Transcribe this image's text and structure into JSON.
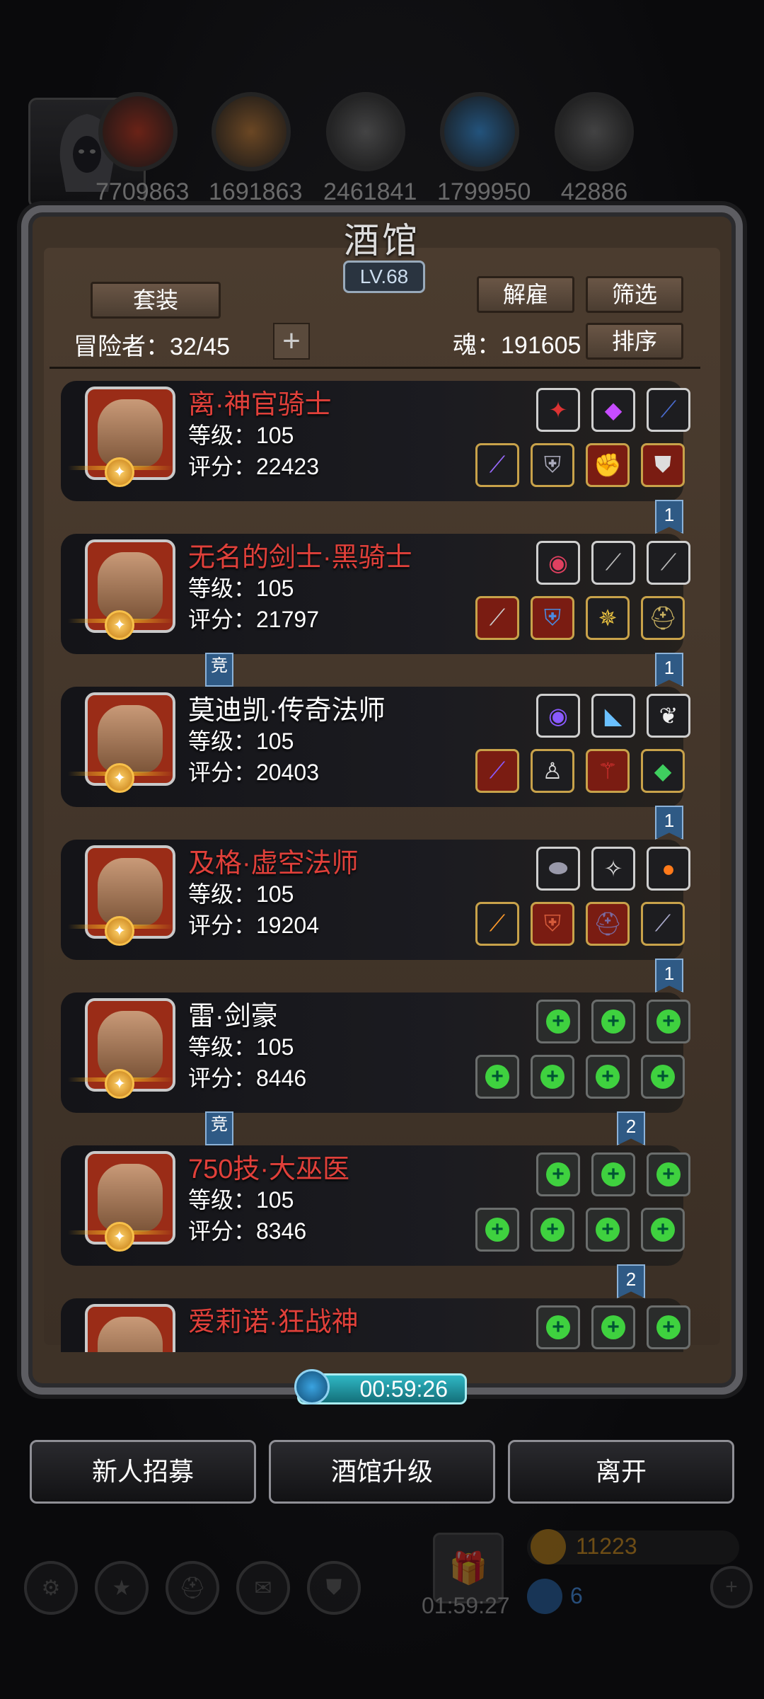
{
  "top_bar": {
    "resources": [
      {
        "icon": "meat-icon",
        "value": "7709863",
        "color": "#8a2a1a"
      },
      {
        "icon": "wood-icon",
        "value": "1691863",
        "color": "#8a5a2a"
      },
      {
        "icon": "iron-icon",
        "value": "2461841",
        "color": "#555555"
      },
      {
        "icon": "crystal-icon",
        "value": "1799950",
        "color": "#2a6aa0"
      },
      {
        "icon": "steel-icon",
        "value": "42886",
        "color": "#555555"
      }
    ]
  },
  "panel": {
    "title": "酒馆",
    "level": "LV.68",
    "set_button": "套装",
    "dismiss_button": "解雇",
    "filter_button": "筛选",
    "sort_button": "排序",
    "adventurer_label": "冒险者：32/45",
    "soul_label": "魂：191605",
    "add_icon": "plus-icon"
  },
  "heroes": [
    {
      "name": "离·神官骑士",
      "name_color": "#e0403a",
      "level": "等级：105",
      "score": "评分：22423",
      "badge": "1",
      "comp": "",
      "top_slots": [
        {
          "icon": "amulet-icon",
          "glyph": "✦",
          "color": "#d33"
        },
        {
          "icon": "gem-icon",
          "glyph": "◆",
          "color": "#c64cff"
        },
        {
          "icon": "bow-icon",
          "glyph": "⟋",
          "color": "#4a6cd0"
        }
      ],
      "bottom_slots": [
        {
          "icon": "staff-icon",
          "glyph": "⟋",
          "color": "#9a6aff",
          "frame": "gold"
        },
        {
          "icon": "armor-icon",
          "glyph": "⛨",
          "color": "#aab",
          "frame": "gold"
        },
        {
          "icon": "gauntlet-icon",
          "glyph": "✊",
          "color": "#e33",
          "frame": "red"
        },
        {
          "icon": "shield-icon",
          "glyph": "⛊",
          "color": "#ddd",
          "frame": "red"
        }
      ]
    },
    {
      "name": "无名的剑士·黑骑士",
      "name_color": "#e0403a",
      "level": "等级：105",
      "score": "评分：21797",
      "badge": "1",
      "comp": "竞",
      "top_slots": [
        {
          "icon": "ring-icon",
          "glyph": "◉",
          "color": "#e04060"
        },
        {
          "icon": "blade-icon",
          "glyph": "⟋",
          "color": "#bbb"
        },
        {
          "icon": "sword-icon",
          "glyph": "⟋",
          "color": "#bbb"
        }
      ],
      "bottom_slots": [
        {
          "icon": "greatsword-icon",
          "glyph": "⟋",
          "color": "#ccc",
          "frame": "red"
        },
        {
          "icon": "armor-icon",
          "glyph": "⛨",
          "color": "#4a8ae0",
          "frame": "red"
        },
        {
          "icon": "boots-icon",
          "glyph": "✵",
          "color": "#e8c040",
          "frame": "gold"
        },
        {
          "icon": "helmet-icon",
          "glyph": "⛑",
          "color": "#c8b060",
          "frame": "gold"
        }
      ]
    },
    {
      "name": "莫迪凯·传奇法师",
      "name_color": "#ffffff",
      "level": "等级：105",
      "score": "评分：20403",
      "badge": "1",
      "comp": "",
      "top_slots": [
        {
          "icon": "orb-icon",
          "glyph": "◉",
          "color": "#8a5aff"
        },
        {
          "icon": "boots-icon",
          "glyph": "◣",
          "color": "#6ac0ff"
        },
        {
          "icon": "wing-icon",
          "glyph": "❦",
          "color": "#eee"
        }
      ],
      "bottom_slots": [
        {
          "icon": "staff-icon",
          "glyph": "⟋",
          "color": "#8a5aff",
          "frame": "red"
        },
        {
          "icon": "robe-icon",
          "glyph": "♙",
          "color": "#ddd",
          "frame": "gold"
        },
        {
          "icon": "pendant-icon",
          "glyph": "⚚",
          "color": "#d33",
          "frame": "red"
        },
        {
          "icon": "emerald-icon",
          "glyph": "◆",
          "color": "#3fcf5f",
          "frame": "gold"
        }
      ]
    },
    {
      "name": "及格·虚空法师",
      "name_color": "#e0403a",
      "level": "等级：105",
      "score": "评分：19204",
      "badge": "1",
      "comp": "",
      "top_slots": [
        {
          "icon": "stone-icon",
          "glyph": "⬬",
          "color": "#99a"
        },
        {
          "icon": "rune-icon",
          "glyph": "✧",
          "color": "#ddd"
        },
        {
          "icon": "fire-orb-icon",
          "glyph": "●",
          "color": "#ff7a1a"
        }
      ],
      "bottom_slots": [
        {
          "icon": "torch-staff-icon",
          "glyph": "⟋",
          "color": "#ff9a2a",
          "frame": "gold"
        },
        {
          "icon": "chest-armor-icon",
          "glyph": "⛨",
          "color": "#d45a3a",
          "frame": "red"
        },
        {
          "icon": "helmet-icon",
          "glyph": "⛑",
          "color": "#7a6aa0",
          "frame": "red"
        },
        {
          "icon": "spear-icon",
          "glyph": "⟋",
          "color": "#aac",
          "frame": "gold"
        }
      ]
    },
    {
      "name": "雷·剑豪",
      "name_color": "#ffffff",
      "level": "等级：105",
      "score": "评分：8446",
      "badge": "2",
      "comp": "竞",
      "empty": true
    },
    {
      "name": "750技·大巫医",
      "name_color": "#e0403a",
      "level": "等级：105",
      "score": "评分：8346",
      "badge": "2",
      "comp": "",
      "empty": true
    },
    {
      "name": "爱莉诺·狂战神",
      "name_color": "#e0403a",
      "level": "",
      "score": "",
      "badge": "",
      "comp": "",
      "empty": true
    }
  ],
  "timer": "00:59:26",
  "buttons": {
    "recruit": "新人招募",
    "upgrade": "酒馆升级",
    "leave": "离开"
  },
  "hud": {
    "gift_timer": "01:59:27",
    "gold": "11223",
    "gems": "6"
  }
}
